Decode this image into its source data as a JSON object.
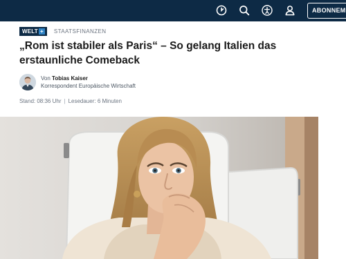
{
  "header": {
    "subscribe_label": "ABONNEMENT",
    "icons": [
      "clock-icon",
      "search-icon",
      "accessibility-icon",
      "user-icon"
    ],
    "background_color": "#0d2a45"
  },
  "article": {
    "brand": "WELT",
    "brand_plus": "+",
    "section": "STAATSFINANZEN",
    "headline": "„Rom ist stabiler als Paris“ – So gelang Italien das erstaunliche Comeback",
    "author": {
      "by_label": "Von",
      "name": "Tobias Kaiser",
      "role": "Korrespondent Europäische Wirtschaft"
    },
    "meta": {
      "stand": "Stand: 08:36 Uhr",
      "reading_time": "Lesedauer: 6 Minuten"
    }
  },
  "hero_image": {
    "description_icon": "article-photo"
  }
}
